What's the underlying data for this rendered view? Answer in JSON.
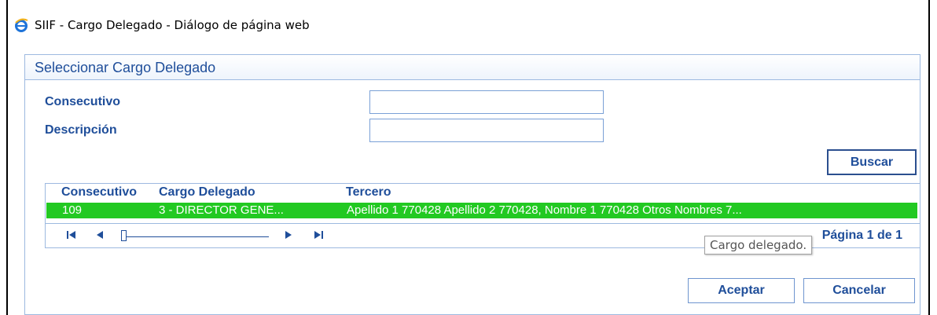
{
  "window": {
    "title": "SIIF - Cargo Delegado - Diálogo de página web",
    "icon": "ie-icon"
  },
  "panel": {
    "title": "Seleccionar Cargo Delegado"
  },
  "form": {
    "consecutivo_label": "Consecutivo",
    "consecutivo_value": "",
    "descripcion_label": "Descripción",
    "descripcion_value": ""
  },
  "buttons": {
    "buscar": "Buscar",
    "aceptar": "Aceptar",
    "cancelar": "Cancelar"
  },
  "grid": {
    "columns": [
      "Consecutivo",
      "Cargo Delegado",
      "Tercero"
    ],
    "rows": [
      {
        "consecutivo": "109",
        "cargo": "3 - DIRECTOR GENE...",
        "tercero": "Apellido 1 770428 Apellido 2 770428, Nombre 1 770428 Otros Nombres 7...",
        "selected": true
      }
    ],
    "pager": {
      "text": "Página 1 de 1",
      "icons": [
        "first-page-icon",
        "prev-page-icon",
        "next-page-icon",
        "last-page-icon"
      ]
    }
  },
  "tooltip": {
    "text": "Cargo delegado."
  },
  "colors": {
    "accent": "#1f4e9a",
    "selected_row": "#22c922",
    "border": "#9db9e0"
  }
}
